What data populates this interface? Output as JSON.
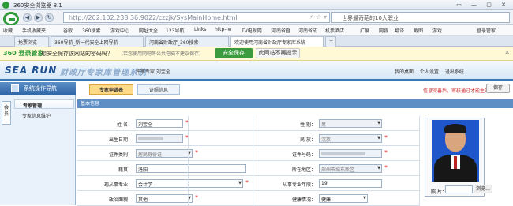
{
  "browser": {
    "title": "360安全浏览器 8.1",
    "url_host": "http://202.102.238.36",
    "url_path": ":9022/czzjk/SysMainHome.html",
    "search_text": "世界最奇葩的10大职业",
    "bookmarks": [
      "收藏",
      "手机收藏夹",
      "谷歌",
      "360搜索",
      "游戏中心",
      "网址大全",
      "123导航",
      "Links",
      "http--w",
      "TV电视网",
      "河南省直",
      "河南省成",
      "机票酒店",
      "扩展",
      "网银",
      "翻译",
      "截图",
      "游戏",
      "登录管家"
    ],
    "tabs": [
      "抢票浏览",
      "360导航_新一代安全上网导航",
      "河南省财政厅_360搜索",
      "欢迎使用河南省财政厅专家库系统"
    ],
    "password_bar": {
      "brand": "360 登录管家",
      "question": "想安全保存该网站的密码吗？",
      "hint": "（若您使用网吧等公共电脑不建议保存）",
      "save_label": "安全保存",
      "never_label": "此网站不再提示"
    }
  },
  "app": {
    "logo": "SEA RUN",
    "system_name": "财政厅专家库管理系统",
    "welcome": "评审专家  刘宝全",
    "header_links": "我的桌面  个人设置  退出系统",
    "nav": {
      "title": "系统操作导航",
      "vertical_tab": "会员",
      "group": "专家管理",
      "item": "专家信息维护"
    },
    "tabs": [
      "专家申请表",
      "证照信息"
    ],
    "notice": "信息完善后，审核通过才能生效",
    "save_label": "保存",
    "section_title": "基本信息",
    "form": {
      "name_label": "姓 名：",
      "name_value": "刘宝全",
      "gender_label": "性 别：",
      "gender_value": "男",
      "birth_label": "出生日期：",
      "ethnicity_label": "民 族：",
      "ethnicity_value": "汉族",
      "idtype_label": "证件类别：",
      "idtype_value": "居民身份证",
      "idno_label": "证件号码：",
      "native_label": "籍贯：",
      "native_value": "洛阳",
      "region_label": "所在地区：",
      "region_value": "郑州市城东新区",
      "major_label": "现从事专业：",
      "major_value": "会计学",
      "years_label": "从事专业年限：",
      "years_value": "19",
      "politics_label": "政治面貌：",
      "politics_value": "其他",
      "health_label": "健康情况：",
      "health_value": "健康",
      "photo_label": "照 片：",
      "browse_label": "浏览..."
    }
  }
}
